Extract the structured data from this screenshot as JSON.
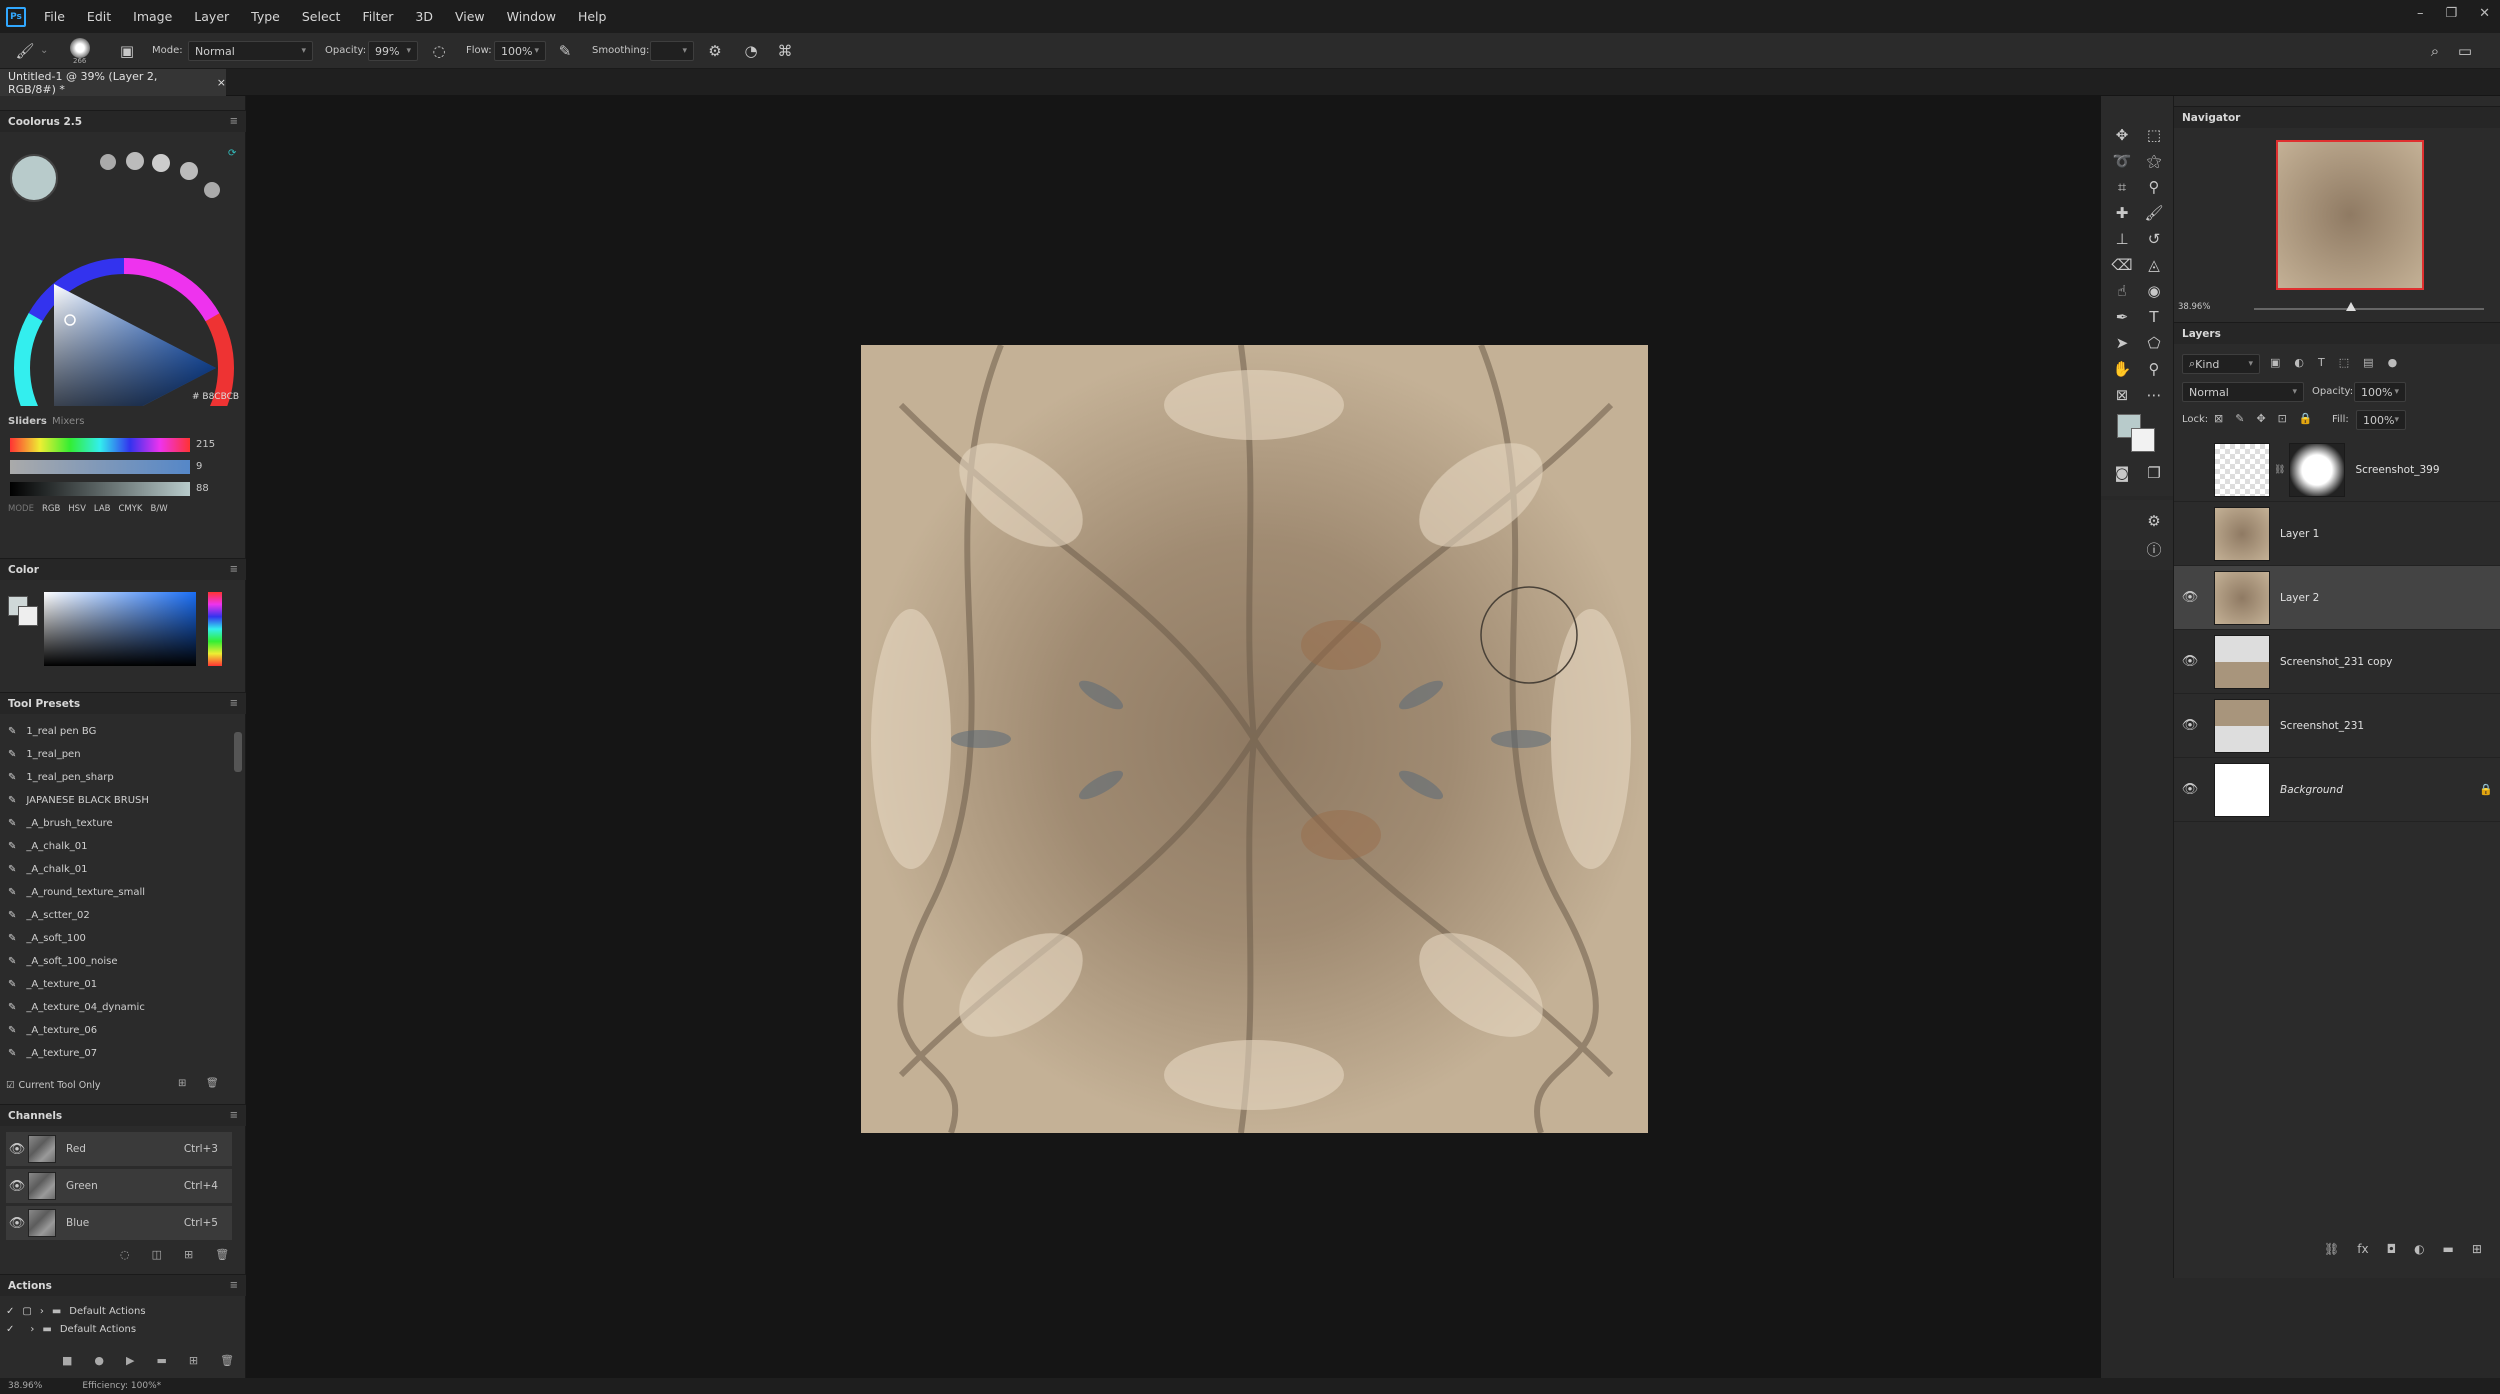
{
  "menubar": {
    "logo": "Ps",
    "items": [
      "File",
      "Edit",
      "Image",
      "Layer",
      "Type",
      "Select",
      "Filter",
      "3D",
      "View",
      "Window",
      "Help"
    ]
  },
  "options": {
    "brush_size": "266",
    "mode_label": "Mode:",
    "mode_value": "Normal",
    "opacity_label": "Opacity:",
    "opacity_value": "99%",
    "flow_label": "Flow:",
    "flow_value": "100%",
    "smoothing_label": "Smoothing:"
  },
  "document": {
    "tab_title": "Untitled-1 @ 39% (Layer 2, RGB/8#) *",
    "close": "×"
  },
  "coolorus": {
    "title": "Coolorus 2.5",
    "hex": "# B8CBCB",
    "tabs": [
      "Sliders",
      "Mixers"
    ],
    "slider_values": [
      "215",
      "9",
      "88"
    ],
    "modes_label": "MODE",
    "modes": [
      "RGB",
      "HSV",
      "LAB",
      "CMYK",
      "B/W"
    ],
    "swatch_color": "#b8cbcb"
  },
  "color_panel": {
    "title": "Color"
  },
  "tool_presets": {
    "title": "Tool Presets",
    "items": [
      "1_real pen BG",
      "1_real_pen",
      "1_real_pen_sharp",
      "JAPANESE BLACK BRUSH",
      "_A_brush_texture",
      "_A_chalk_01",
      "_A_chalk_01",
      "_A_round_texture_small",
      "_A_sctter_02",
      "_A_soft_100",
      "_A_soft_100_noise",
      "_A_texture_01",
      "_A_texture_04_dynamic",
      "_A_texture_06",
      "_A_texture_07"
    ],
    "current_tool_only": "Current Tool Only"
  },
  "channels": {
    "title": "Channels",
    "rows": [
      {
        "name": "Red",
        "shortcut": "Ctrl+3"
      },
      {
        "name": "Green",
        "shortcut": "Ctrl+4"
      },
      {
        "name": "Blue",
        "shortcut": "Ctrl+5"
      }
    ]
  },
  "actions": {
    "title": "Actions",
    "rows": [
      "Default Actions",
      "Default Actions"
    ]
  },
  "navigator": {
    "title": "Navigator",
    "zoom": "38.96%"
  },
  "layers": {
    "title": "Layers",
    "filter_kind": "Kind",
    "blend_mode": "Normal",
    "opacity_label": "Opacity:",
    "opacity_value": "100%",
    "lock_label": "Lock:",
    "fill_label": "Fill:",
    "fill_value": "100%",
    "rows": [
      {
        "name": "Screenshot_399",
        "visible": false
      },
      {
        "name": "Layer 1",
        "visible": false
      },
      {
        "name": "Layer 2",
        "visible": true,
        "selected": true
      },
      {
        "name": "Screenshot_231 copy",
        "visible": true
      },
      {
        "name": "Screenshot_231",
        "visible": true
      },
      {
        "name": "Background",
        "visible": true,
        "locked": true
      }
    ]
  },
  "status": {
    "zoom": "38.96%",
    "efficiency": "Efficiency: 100%*"
  },
  "colors": {
    "accent": "#31a8ff",
    "canvas_bg": "#151515",
    "panel_bg": "#2b2b2b",
    "artwork_base": "#b7a48a"
  }
}
